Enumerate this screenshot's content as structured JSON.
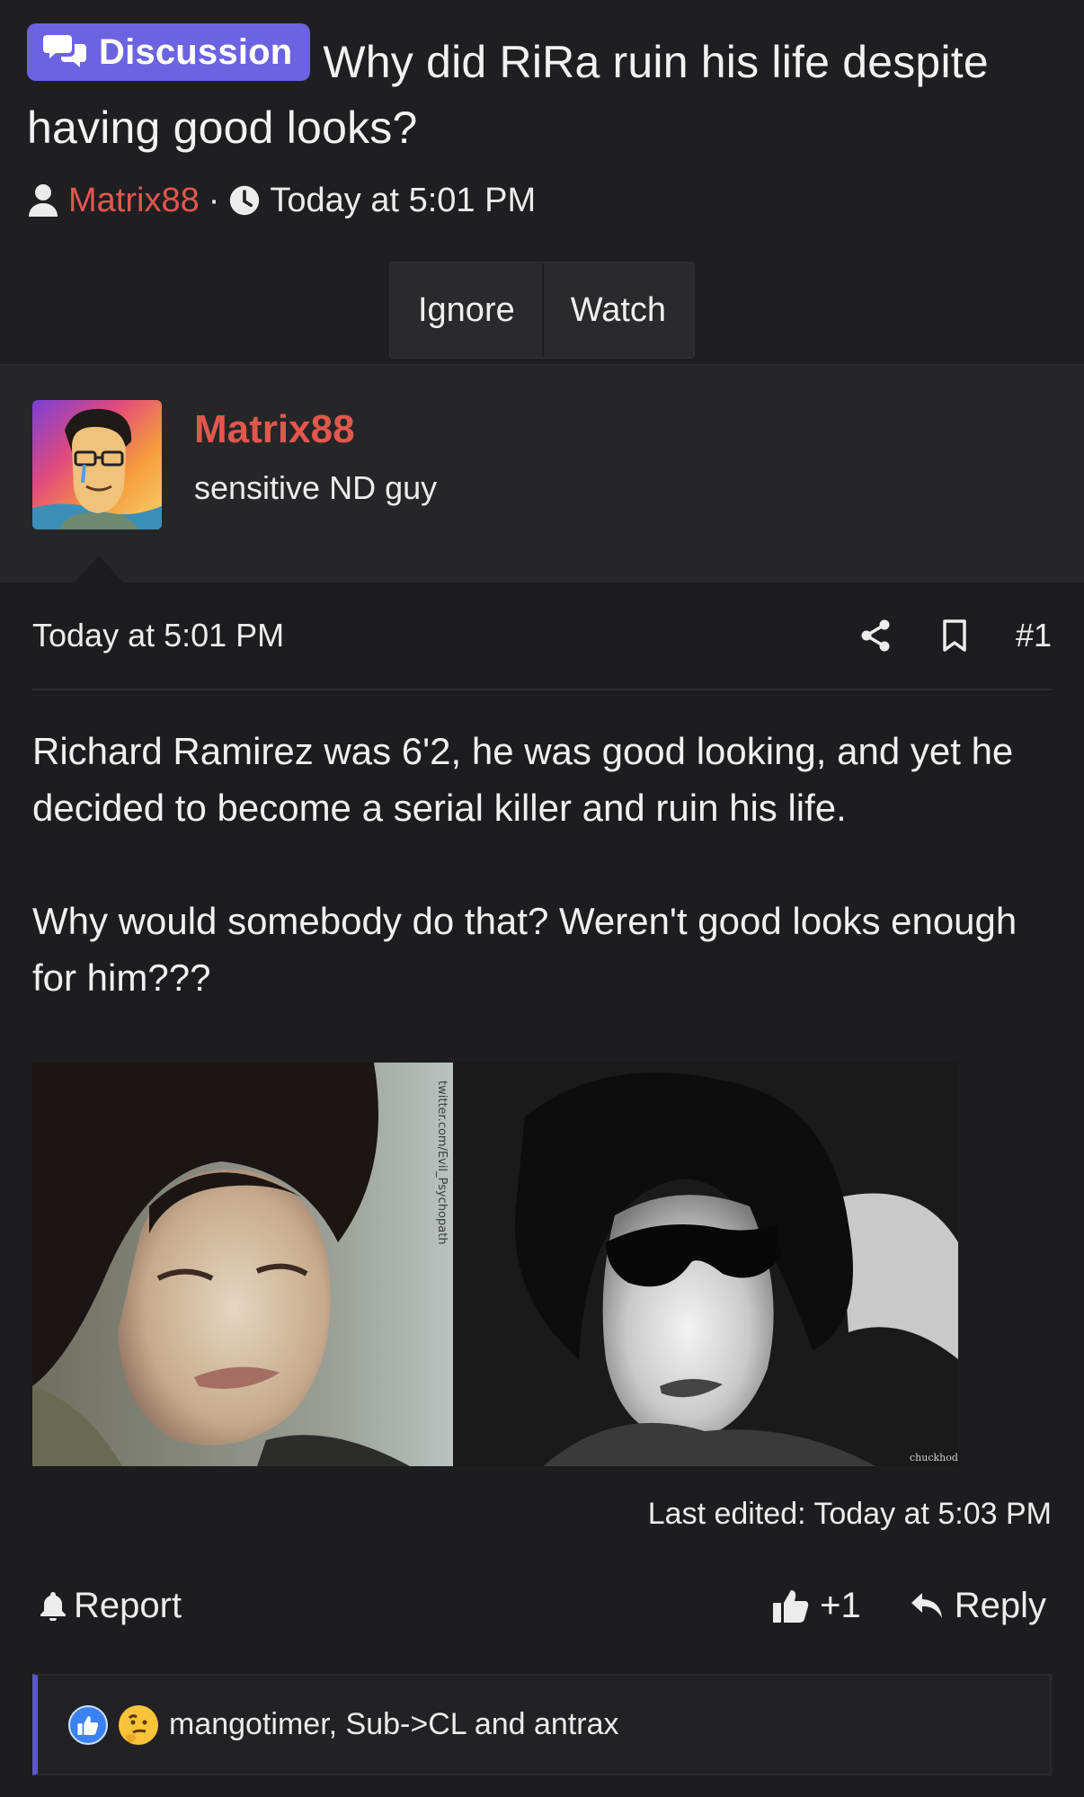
{
  "thread": {
    "prefix": "Discussion",
    "title": "Why did RiRa ruin his life despite having good looks?",
    "author": "Matrix88",
    "separator": "·",
    "time": "Today at 5:01 PM",
    "actions": {
      "ignore": "Ignore",
      "watch": "Watch"
    }
  },
  "user": {
    "name": "Matrix88",
    "title": "sensitive ND guy"
  },
  "post": {
    "date": "Today at 5:01 PM",
    "number": "#1",
    "paragraphs": [
      "Richard Ramirez was 6'2, he was good looking, and yet he decided to become a serial killer and ruin his life.",
      "Why would somebody do that? Weren't good looks enough for him???"
    ],
    "image_watermark_left": "twitter.com/Evil_Psychopath",
    "image_watermark_right": "chuckhodi",
    "last_edited": "Last edited: Today at 5:03 PM",
    "report": "Report",
    "like": "+1",
    "reply": "Reply"
  },
  "reactions": {
    "users": "mangotimer, Sub->CL and antrax"
  },
  "colors": {
    "accent": "#6b63e0",
    "username": "#e2574c",
    "background": "#1d1d1f"
  }
}
